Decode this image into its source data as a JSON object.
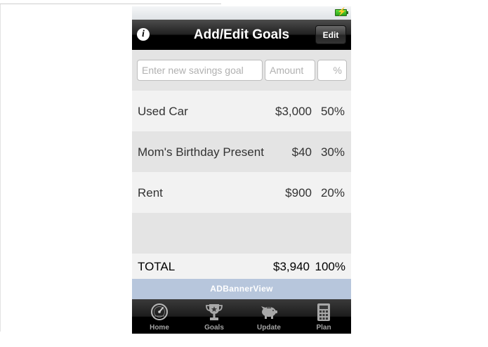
{
  "status_bar": {
    "battery_icon": "battery-charging-icon"
  },
  "nav": {
    "title": "Add/Edit Goals",
    "info_icon": "info-icon",
    "info_glyph": "i",
    "edit_label": "Edit"
  },
  "inputs": {
    "goal_placeholder": "Enter new savings goal",
    "amount_placeholder": "Amount",
    "percent_placeholder": "%",
    "goal_value": "",
    "amount_value": "",
    "percent_value": ""
  },
  "goals": [
    {
      "name": "Used Car",
      "amount": "$3,000",
      "percent": "50%"
    },
    {
      "name": "Mom's Birthday Present",
      "amount": "$40",
      "percent": "30%"
    },
    {
      "name": "Rent",
      "amount": "$900",
      "percent": "20%"
    }
  ],
  "total": {
    "label": "TOTAL",
    "amount": "$3,940",
    "percent": "100%"
  },
  "ad_banner": {
    "label": "ADBannerView"
  },
  "tabs": [
    {
      "label": "Home",
      "icon": "speedometer-icon"
    },
    {
      "label": "Goals",
      "icon": "trophy-icon"
    },
    {
      "label": "Update",
      "icon": "piggy-bank-icon"
    },
    {
      "label": "Plan",
      "icon": "calculator-icon"
    }
  ],
  "colors": {
    "nav_bar": "#000000",
    "ad_banner": "#b7c6dc",
    "tab_label": "#a4a4a4",
    "row_light": "#f2f2f2",
    "row_dark": "#e4e4e4"
  }
}
